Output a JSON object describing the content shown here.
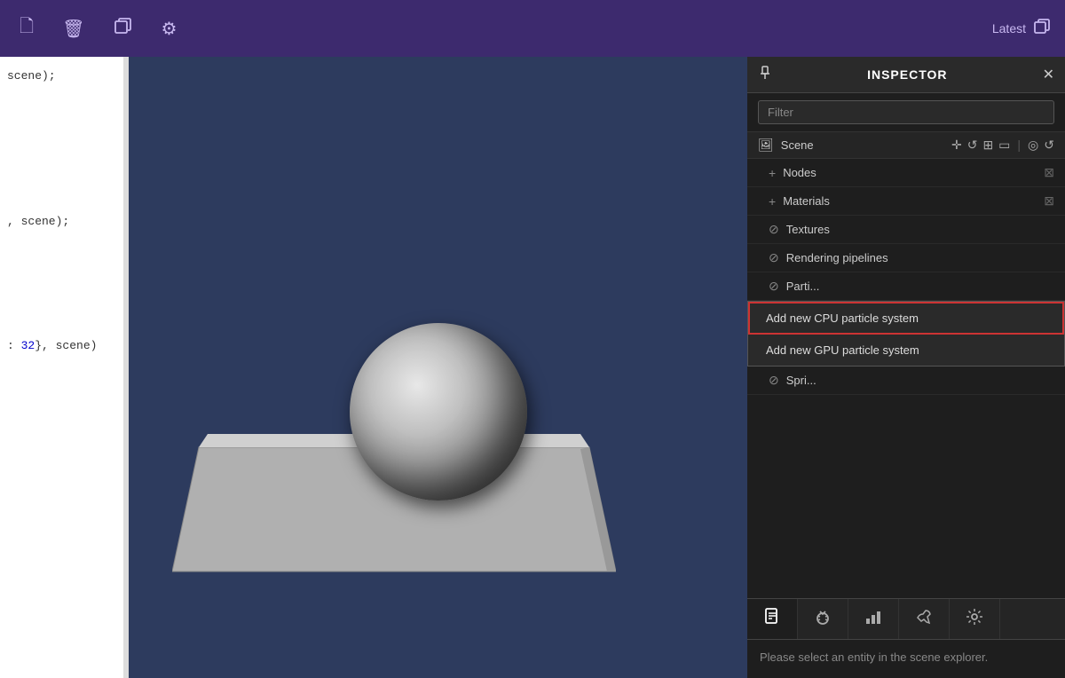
{
  "toolbar": {
    "icons": [
      {
        "name": "file-icon",
        "symbol": "🗋"
      },
      {
        "name": "delete-icon",
        "symbol": "🗑"
      },
      {
        "name": "duplicate-icon",
        "symbol": "⬡"
      },
      {
        "name": "settings-icon",
        "symbol": "⚙"
      }
    ],
    "version_label": "Latest",
    "version_icon": "⬡"
  },
  "inspector": {
    "title": "INSPECTOR",
    "pin_icon": "📌",
    "close_icon": "✕",
    "filter_placeholder": "Filter",
    "scene_label": "Scene",
    "scene_icons": [
      "✛",
      "↺",
      "⊞",
      "▭",
      "|",
      "◎",
      "↺"
    ],
    "items": [
      {
        "label": "Nodes",
        "icon": "+",
        "expand": "⊠"
      },
      {
        "label": "Materials",
        "icon": "+",
        "expand": "⊠"
      },
      {
        "label": "Textures",
        "icon": "⊘",
        "expand": ""
      },
      {
        "label": "Rendering pipelines",
        "icon": "⊘",
        "expand": ""
      },
      {
        "label": "Parti...",
        "icon": "⊘",
        "expand": ""
      },
      {
        "label": "Spri...",
        "icon": "⊘",
        "expand": ""
      }
    ],
    "dropdown": {
      "items": [
        {
          "label": "Add new CPU particle system",
          "highlighted": true
        },
        {
          "label": "Add new GPU particle system",
          "highlighted": false
        }
      ]
    }
  },
  "bottom_panel": {
    "tabs": [
      {
        "icon": "📄",
        "name": "document-tab",
        "active": true
      },
      {
        "icon": "🐛",
        "name": "debug-tab",
        "active": false
      },
      {
        "icon": "📊",
        "name": "stats-tab",
        "active": false
      },
      {
        "icon": "🔧",
        "name": "tools-tab",
        "active": false
      },
      {
        "icon": "⚙",
        "name": "settings-tab",
        "active": false
      }
    ],
    "message": "Please select an entity in the scene explorer."
  },
  "code_panel": {
    "lines": [
      {
        "text": "scene);"
      },
      {
        "text": ""
      },
      {
        "text": ""
      },
      {
        "text": ", scene);"
      },
      {
        "text": ""
      },
      {
        "text": ""
      },
      {
        "text": ": 32}, scene)"
      }
    ]
  }
}
